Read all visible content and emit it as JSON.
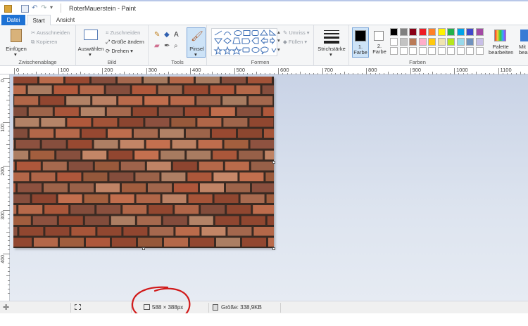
{
  "window": {
    "title": "RoterMauerstein - Paint"
  },
  "tabs": [
    {
      "label": "Datei"
    },
    {
      "label": "Start"
    },
    {
      "label": "Ansicht"
    }
  ],
  "ribbon": {
    "clipboard": {
      "label": "Zwischenablage",
      "paste": "Einfügen",
      "cut": "Ausschneiden",
      "copy": "Kopieren"
    },
    "image": {
      "label": "Bild",
      "select": "Auswählen",
      "crop": "Zuschneiden",
      "resize": "Größe ändern",
      "rotate": "Drehen"
    },
    "tools": {
      "label": "Tools",
      "brush": "Pinsel"
    },
    "shapes": {
      "label": "Formen",
      "outline": "Umriss",
      "fill": "Füllen"
    },
    "stroke": {
      "label": "Strichstärke"
    },
    "colors": {
      "label": "Farben",
      "color1_line1": "1.",
      "color1_line2": "Farbe",
      "color2_line1": "2.",
      "color2_line2": "Farbe",
      "edit_line1": "Palette",
      "edit_line2": "bearbeiten",
      "edit_more_line1": "Mit",
      "edit_more_line2": "bea",
      "color1": "#000000",
      "color2": "#ffffff",
      "palette_row1": [
        "#000000",
        "#7f7f7f",
        "#880015",
        "#ed1c24",
        "#ff7f27",
        "#fff200",
        "#22b14c",
        "#00a2e8",
        "#3f48cc",
        "#a349a4"
      ],
      "palette_row2": [
        "#ffffff",
        "#c3c3c3",
        "#b97a57",
        "#ffaec9",
        "#ffc90e",
        "#efe4b0",
        "#b5e61d",
        "#99d9ea",
        "#7092be",
        "#c8bfe7"
      ]
    }
  },
  "ruler": {
    "h_labels": [
      "0",
      "100",
      "200",
      "300",
      "400",
      "500",
      "600",
      "700",
      "800",
      "900",
      "1000",
      "1100"
    ],
    "v_labels": [
      "0",
      "100",
      "200",
      "300",
      "400"
    ]
  },
  "status": {
    "dimensions": "588 × 388px",
    "filesize": "Größe: 338,9KB"
  },
  "canvas": {
    "brick_colors": [
      "#9a4a32",
      "#b35a3c",
      "#a86a4f",
      "#c4704f",
      "#8e5240",
      "#b8876a",
      "#a5603f",
      "#c98a6a"
    ],
    "mortar": "#3a2a22"
  }
}
